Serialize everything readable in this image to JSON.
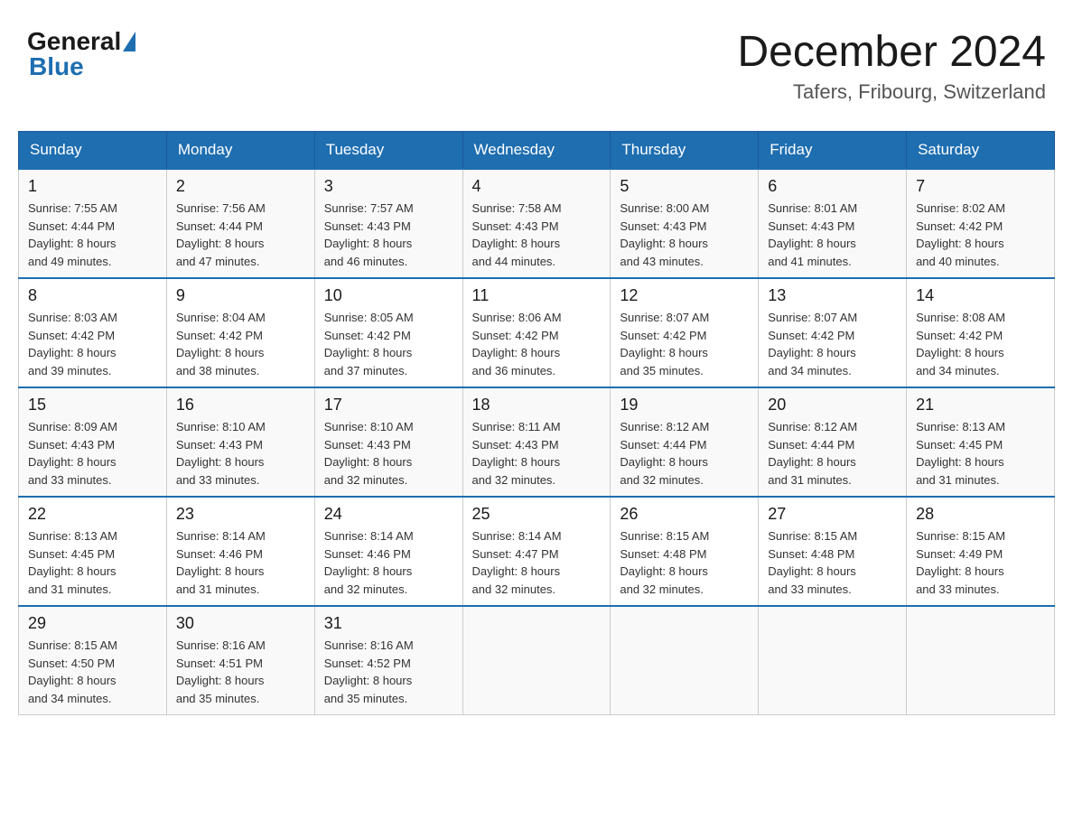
{
  "header": {
    "logo_general": "General",
    "logo_blue": "Blue",
    "month_title": "December 2024",
    "location": "Tafers, Fribourg, Switzerland"
  },
  "days_of_week": [
    "Sunday",
    "Monday",
    "Tuesday",
    "Wednesday",
    "Thursday",
    "Friday",
    "Saturday"
  ],
  "weeks": [
    [
      {
        "day": "1",
        "sunrise": "7:55 AM",
        "sunset": "4:44 PM",
        "daylight": "8 hours and 49 minutes."
      },
      {
        "day": "2",
        "sunrise": "7:56 AM",
        "sunset": "4:44 PM",
        "daylight": "8 hours and 47 minutes."
      },
      {
        "day": "3",
        "sunrise": "7:57 AM",
        "sunset": "4:43 PM",
        "daylight": "8 hours and 46 minutes."
      },
      {
        "day": "4",
        "sunrise": "7:58 AM",
        "sunset": "4:43 PM",
        "daylight": "8 hours and 44 minutes."
      },
      {
        "day": "5",
        "sunrise": "8:00 AM",
        "sunset": "4:43 PM",
        "daylight": "8 hours and 43 minutes."
      },
      {
        "day": "6",
        "sunrise": "8:01 AM",
        "sunset": "4:43 PM",
        "daylight": "8 hours and 41 minutes."
      },
      {
        "day": "7",
        "sunrise": "8:02 AM",
        "sunset": "4:42 PM",
        "daylight": "8 hours and 40 minutes."
      }
    ],
    [
      {
        "day": "8",
        "sunrise": "8:03 AM",
        "sunset": "4:42 PM",
        "daylight": "8 hours and 39 minutes."
      },
      {
        "day": "9",
        "sunrise": "8:04 AM",
        "sunset": "4:42 PM",
        "daylight": "8 hours and 38 minutes."
      },
      {
        "day": "10",
        "sunrise": "8:05 AM",
        "sunset": "4:42 PM",
        "daylight": "8 hours and 37 minutes."
      },
      {
        "day": "11",
        "sunrise": "8:06 AM",
        "sunset": "4:42 PM",
        "daylight": "8 hours and 36 minutes."
      },
      {
        "day": "12",
        "sunrise": "8:07 AM",
        "sunset": "4:42 PM",
        "daylight": "8 hours and 35 minutes."
      },
      {
        "day": "13",
        "sunrise": "8:07 AM",
        "sunset": "4:42 PM",
        "daylight": "8 hours and 34 minutes."
      },
      {
        "day": "14",
        "sunrise": "8:08 AM",
        "sunset": "4:42 PM",
        "daylight": "8 hours and 34 minutes."
      }
    ],
    [
      {
        "day": "15",
        "sunrise": "8:09 AM",
        "sunset": "4:43 PM",
        "daylight": "8 hours and 33 minutes."
      },
      {
        "day": "16",
        "sunrise": "8:10 AM",
        "sunset": "4:43 PM",
        "daylight": "8 hours and 33 minutes."
      },
      {
        "day": "17",
        "sunrise": "8:10 AM",
        "sunset": "4:43 PM",
        "daylight": "8 hours and 32 minutes."
      },
      {
        "day": "18",
        "sunrise": "8:11 AM",
        "sunset": "4:43 PM",
        "daylight": "8 hours and 32 minutes."
      },
      {
        "day": "19",
        "sunrise": "8:12 AM",
        "sunset": "4:44 PM",
        "daylight": "8 hours and 32 minutes."
      },
      {
        "day": "20",
        "sunrise": "8:12 AM",
        "sunset": "4:44 PM",
        "daylight": "8 hours and 31 minutes."
      },
      {
        "day": "21",
        "sunrise": "8:13 AM",
        "sunset": "4:45 PM",
        "daylight": "8 hours and 31 minutes."
      }
    ],
    [
      {
        "day": "22",
        "sunrise": "8:13 AM",
        "sunset": "4:45 PM",
        "daylight": "8 hours and 31 minutes."
      },
      {
        "day": "23",
        "sunrise": "8:14 AM",
        "sunset": "4:46 PM",
        "daylight": "8 hours and 31 minutes."
      },
      {
        "day": "24",
        "sunrise": "8:14 AM",
        "sunset": "4:46 PM",
        "daylight": "8 hours and 32 minutes."
      },
      {
        "day": "25",
        "sunrise": "8:14 AM",
        "sunset": "4:47 PM",
        "daylight": "8 hours and 32 minutes."
      },
      {
        "day": "26",
        "sunrise": "8:15 AM",
        "sunset": "4:48 PM",
        "daylight": "8 hours and 32 minutes."
      },
      {
        "day": "27",
        "sunrise": "8:15 AM",
        "sunset": "4:48 PM",
        "daylight": "8 hours and 33 minutes."
      },
      {
        "day": "28",
        "sunrise": "8:15 AM",
        "sunset": "4:49 PM",
        "daylight": "8 hours and 33 minutes."
      }
    ],
    [
      {
        "day": "29",
        "sunrise": "8:15 AM",
        "sunset": "4:50 PM",
        "daylight": "8 hours and 34 minutes."
      },
      {
        "day": "30",
        "sunrise": "8:16 AM",
        "sunset": "4:51 PM",
        "daylight": "8 hours and 35 minutes."
      },
      {
        "day": "31",
        "sunrise": "8:16 AM",
        "sunset": "4:52 PM",
        "daylight": "8 hours and 35 minutes."
      },
      null,
      null,
      null,
      null
    ]
  ],
  "labels": {
    "sunrise": "Sunrise:",
    "sunset": "Sunset:",
    "daylight": "Daylight:"
  }
}
